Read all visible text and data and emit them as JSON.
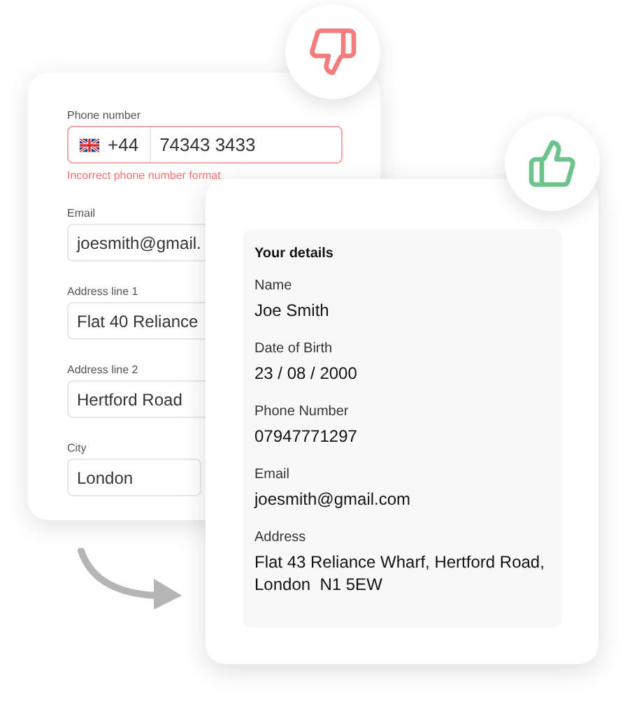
{
  "form": {
    "fields": [
      {
        "kind": "phone",
        "label": "Phone number",
        "prefix": "+44",
        "value": "74343 3433",
        "invalid": true,
        "error": "Incorrect phone number format"
      },
      {
        "kind": "text",
        "label": "Email",
        "value": "joesmith@gmail.",
        "invalid": false
      },
      {
        "kind": "text",
        "label": "Address line 1",
        "value": "Flat 40 Reliance",
        "invalid": false
      },
      {
        "kind": "text",
        "label": "Address line 2",
        "value": "Hertford Road",
        "invalid": false
      },
      {
        "kind": "short",
        "label": "City",
        "value": "London",
        "invalid": false
      }
    ]
  },
  "details": {
    "title": "Your details",
    "items": [
      {
        "label": "Name",
        "lines": [
          "Joe Smith"
        ]
      },
      {
        "label": "Date of Birth",
        "lines": [
          "23 / 08 / 2000"
        ]
      },
      {
        "label": "Phone Number",
        "lines": [
          "07947771297"
        ]
      },
      {
        "label": "Email",
        "lines": [
          "joesmith@gmail.com"
        ]
      },
      {
        "label": "Address",
        "lines": [
          "Flat 43 Reliance Wharf, Hertford Road,",
          "London  N1 5EW"
        ]
      }
    ]
  }
}
